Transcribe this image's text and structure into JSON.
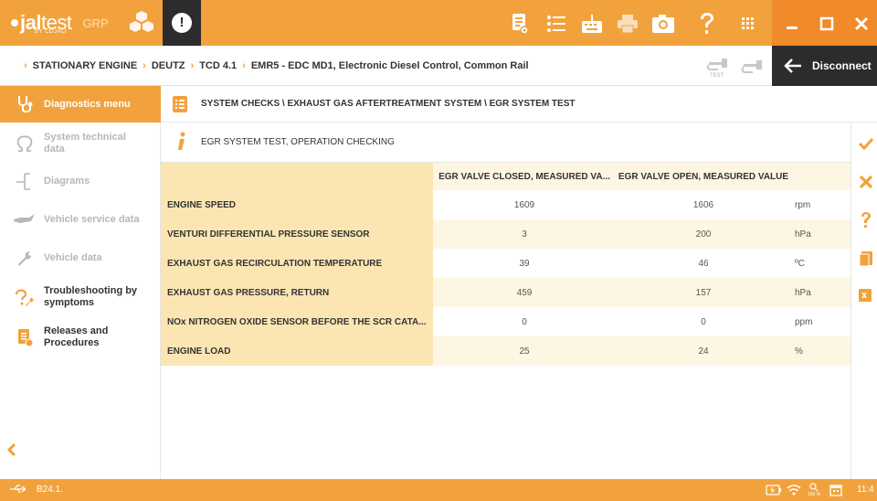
{
  "app": {
    "brand_bold": "jal",
    "brand_thin": "test",
    "byline": "BY COJALI",
    "grp": "GRP",
    "alert": "!"
  },
  "toolbar": {
    "icons": [
      "report-icon",
      "list-icon",
      "keyboard-icon",
      "printer-icon",
      "camera-icon",
      "help-icon",
      "apps-grid-icon",
      "minimize-icon",
      "maximize-icon",
      "close-icon"
    ]
  },
  "breadcrumb": {
    "items": [
      "STATIONARY ENGINE",
      "DEUTZ",
      "TCD 4.1",
      "EMR5 - EDC MD1, Electronic Diesel Control, Common Rail"
    ],
    "test_label": "TEST"
  },
  "disconnect": {
    "label": "Disconnect"
  },
  "sidebar": {
    "items": [
      {
        "label": "Diagnostics menu",
        "icon": "stethoscope-icon",
        "state": "active"
      },
      {
        "label": "System technical data",
        "icon": "omega-icon",
        "state": "dim"
      },
      {
        "label": "Diagrams",
        "icon": "diagram-icon",
        "state": "dim"
      },
      {
        "label": "Vehicle service data",
        "icon": "oil-can-icon",
        "state": "dim"
      },
      {
        "label": "Vehicle data",
        "icon": "wrench-icon",
        "state": "dim"
      },
      {
        "label": "Troubleshooting by symptoms",
        "icon": "troubleshoot-icon",
        "state": "dark"
      },
      {
        "label": "Releases and Procedures",
        "icon": "procedures-icon",
        "state": "dark"
      }
    ]
  },
  "main": {
    "path": "SYSTEM CHECKS \\ EXHAUST GAS AFTERTREATMENT SYSTEM \\ EGR SYSTEM TEST",
    "info": "EGR SYSTEM TEST, OPERATION CHECKING"
  },
  "table": {
    "headers": [
      "",
      "EGR VALVE CLOSED, MEASURED VA...",
      "EGR VALVE OPEN, MEASURED VALUE",
      ""
    ],
    "rows": [
      {
        "name": "ENGINE SPEED",
        "closed": "1609",
        "open": "1606",
        "unit": "rpm"
      },
      {
        "name": "VENTURI DIFFERENTIAL PRESSURE SENSOR",
        "closed": "3",
        "open": "200",
        "unit": "hPa"
      },
      {
        "name": "EXHAUST GAS RECIRCULATION TEMPERATURE",
        "closed": "39",
        "open": "46",
        "unit": "ºC"
      },
      {
        "name": "EXHAUST GAS PRESSURE, RETURN",
        "closed": "459",
        "open": "157",
        "unit": "hPa"
      },
      {
        "name": "NOx NITROGEN OXIDE SENSOR BEFORE THE SCR CATA...",
        "closed": "0",
        "open": "0",
        "unit": "ppm"
      },
      {
        "name": "ENGINE LOAD",
        "closed": "25",
        "open": "24",
        "unit": "%"
      }
    ]
  },
  "rightbar": {
    "icons": [
      "confirm-icon",
      "cancel-icon",
      "help-icon",
      "clipboard-icon",
      "export-icon"
    ]
  },
  "status": {
    "version": "B24.1.",
    "zoom": "100 %",
    "time": "11:4"
  },
  "colors": {
    "accent": "#f2a23c",
    "dark": "#2c2c2c",
    "highlight": "#fbe6b3"
  }
}
